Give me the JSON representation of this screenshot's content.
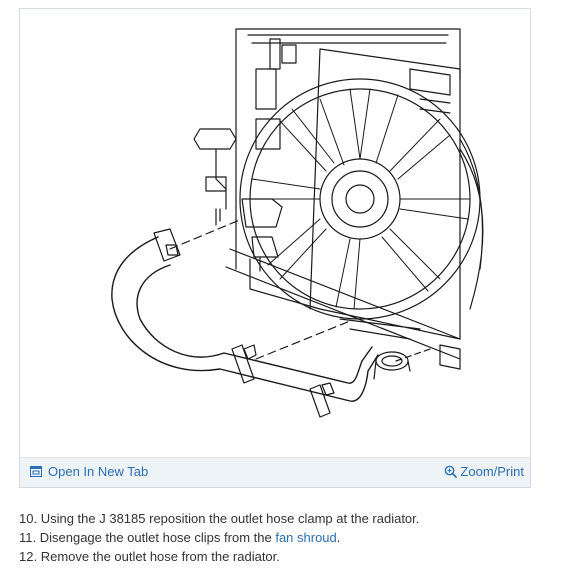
{
  "figure": {
    "open_tab_label": "Open In New Tab",
    "zoom_label": "Zoom/Print",
    "icons": {
      "open_tab": "open-in-new-tab-icon",
      "zoom": "zoom-in-icon"
    }
  },
  "steps": [
    {
      "num": "10.",
      "text": "Using the J 38185 reposition the outlet hose clamp at the radiator."
    },
    {
      "num": "11.",
      "text_before": "Disengage the outlet hose clips from the ",
      "link": "fan shroud",
      "text_after": "."
    },
    {
      "num": "12.",
      "text": "Remove the outlet hose from the radiator."
    }
  ],
  "colors": {
    "link": "#2a6fb3",
    "bar": "#eef3f8"
  }
}
